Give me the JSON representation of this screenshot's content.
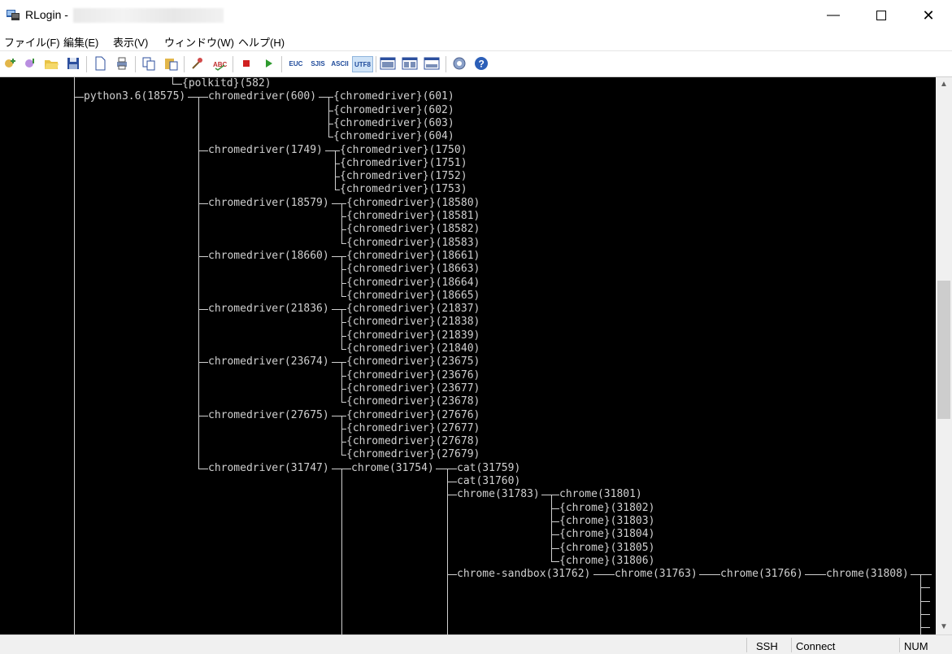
{
  "window": {
    "title": "RLogin -"
  },
  "menu": [
    "ファイル(F)",
    "編集(E)",
    "表示(V)",
    "ウィンドウ(W)",
    "ヘルプ(H)"
  ],
  "toolbar": {
    "icons": [
      "new-connection-icon",
      "connect-icon",
      "open-folder-icon",
      "save-icon",
      "new-document-icon",
      "print-icon",
      "copy-icon",
      "paste-icon",
      "script-icon",
      "spell-check-icon",
      "stop-icon",
      "play-icon",
      "layout-one-icon",
      "layout-two-icon",
      "layout-three-icon",
      "settings-gear-icon",
      "help-icon"
    ],
    "encodings": [
      "EUC",
      "SJIS",
      "ASCII",
      "UTF8"
    ]
  },
  "status": {
    "protocol": "SSH",
    "state": "Connect",
    "num": "NUM"
  },
  "terminal": {
    "top": "{polkitd}(582)",
    "root": "python3.6(18575)",
    "drivers": [
      {
        "name": "chromedriver(600)",
        "children": [
          "{chromedriver}(601)",
          "{chromedriver}(602)",
          "{chromedriver}(603)",
          "{chromedriver}(604)"
        ]
      },
      {
        "name": "chromedriver(1749)",
        "children": [
          "{chromedriver}(1750)",
          "{chromedriver}(1751)",
          "{chromedriver}(1752)",
          "{chromedriver}(1753)"
        ]
      },
      {
        "name": "chromedriver(18579)",
        "children": [
          "{chromedriver}(18580)",
          "{chromedriver}(18581)",
          "{chromedriver}(18582)",
          "{chromedriver}(18583)"
        ]
      },
      {
        "name": "chromedriver(18660)",
        "children": [
          "{chromedriver}(18661)",
          "{chromedriver}(18663)",
          "{chromedriver}(18664)",
          "{chromedriver}(18665)"
        ]
      },
      {
        "name": "chromedriver(21836)",
        "children": [
          "{chromedriver}(21837)",
          "{chromedriver}(21838)",
          "{chromedriver}(21839)",
          "{chromedriver}(21840)"
        ]
      },
      {
        "name": "chromedriver(23674)",
        "children": [
          "{chromedriver}(23675)",
          "{chromedriver}(23676)",
          "{chromedriver}(23677)",
          "{chromedriver}(23678)"
        ]
      },
      {
        "name": "chromedriver(27675)",
        "children": [
          "{chromedriver}(27676)",
          "{chromedriver}(27677)",
          "{chromedriver}(27678)",
          "{chromedriver}(27679)"
        ]
      }
    ],
    "last_driver": "chromedriver(31747)",
    "chrome": "chrome(31754)",
    "cats": [
      "cat(31759)",
      "cat(31760)"
    ],
    "chrome2": "chrome(31783)",
    "chrome2_children": [
      "chrome(31801)",
      "{chrome}(31802)",
      "{chrome}(31803)",
      "{chrome}(31804)",
      "{chrome}(31805)",
      "{chrome}(31806)"
    ],
    "sandbox_chain": [
      "chrome-sandbox(31762)",
      "chrome(31763)",
      "chrome(31766)",
      "chrome(31808)"
    ]
  }
}
